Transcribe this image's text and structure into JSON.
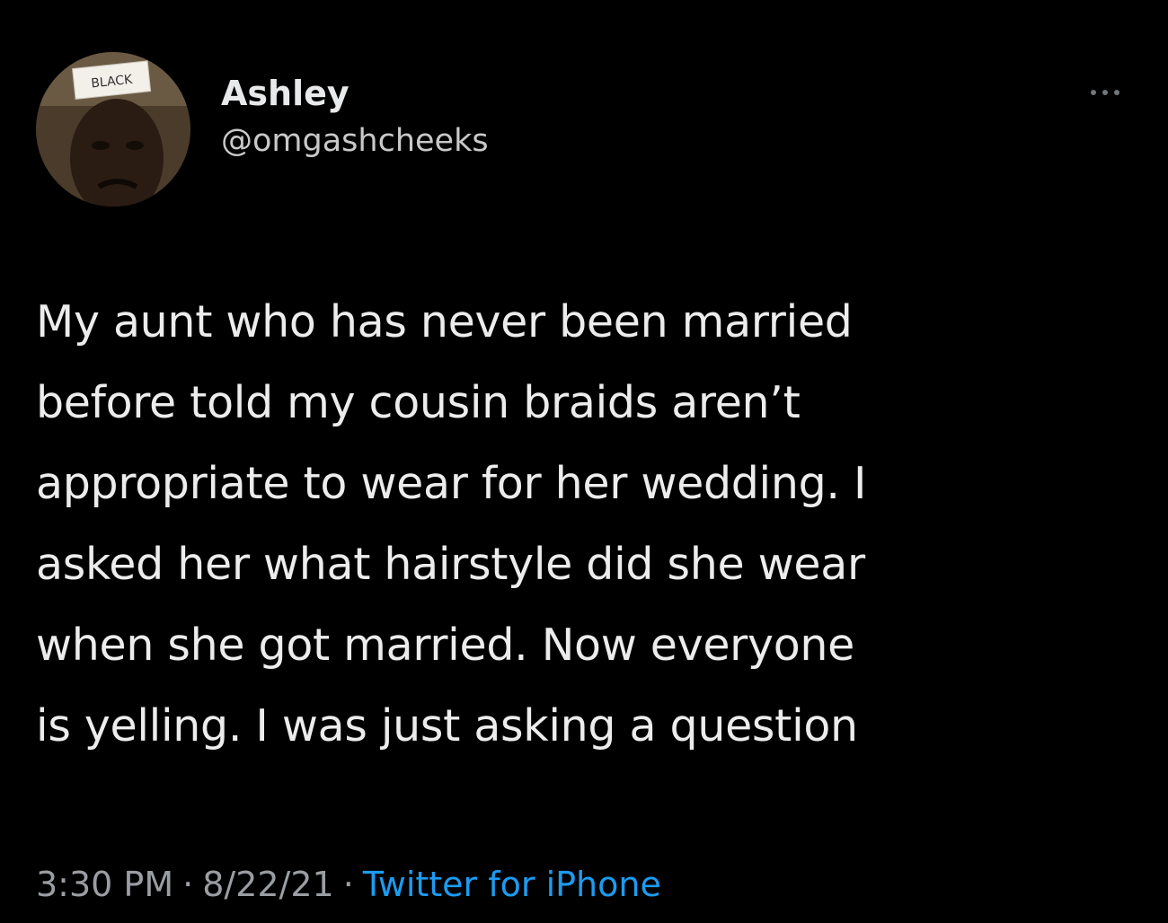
{
  "colors": {
    "background": "#000000",
    "primary_text": "#e7e9ea",
    "secondary_text": "#9a9ea3",
    "link": "#1d9bf0"
  },
  "author": {
    "display_name": "Ashley",
    "handle": "@omgashcheeks",
    "avatar_label": "BLACK"
  },
  "more_button": {
    "icon": "more-horizontal-icon"
  },
  "tweet": {
    "lines": [
      "My aunt who has never been married",
      "before told my cousin braids aren’t",
      "appropriate to wear for her wedding. I",
      "asked her what hairstyle did she wear",
      "when she got married. Now everyone",
      "is yelling. I was just asking a question"
    ]
  },
  "meta": {
    "time": "3:30 PM",
    "separator": "·",
    "date": "8/22/21",
    "source": "Twitter for iPhone"
  }
}
